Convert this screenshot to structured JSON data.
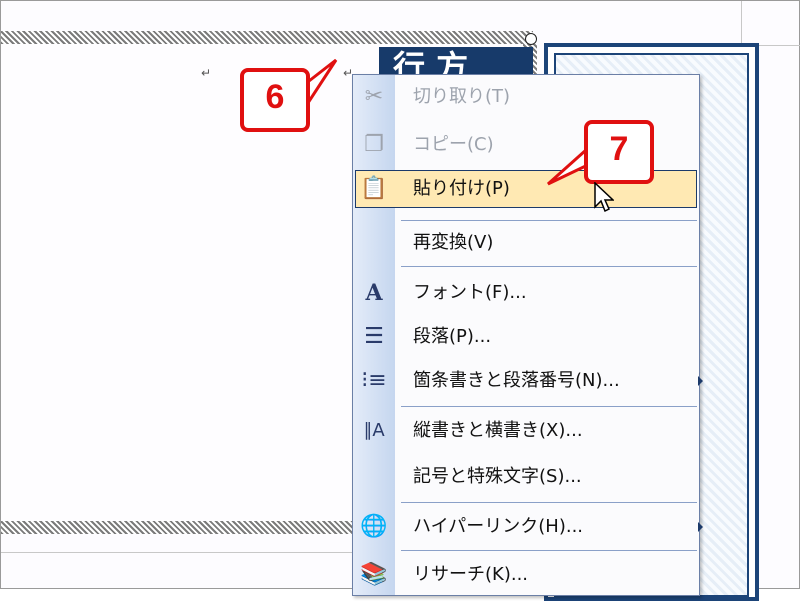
{
  "document": {
    "vertical_text": "行 方"
  },
  "callouts": {
    "step6": "6",
    "step7": "7"
  },
  "context_menu": {
    "items": [
      {
        "label": "切り取り(T)",
        "icon": "scissors-icon",
        "enabled": false
      },
      {
        "label": "コピー(C)",
        "icon": "copy-icon",
        "enabled": false
      },
      {
        "label": "貼り付け(P)",
        "icon": "paste-icon",
        "enabled": true,
        "highlighted": true
      },
      {
        "label": "再変換(V)",
        "icon": "",
        "enabled": true
      },
      {
        "label": "フォント(F)...",
        "icon": "font-icon",
        "enabled": true
      },
      {
        "label": "段落(P)...",
        "icon": "paragraph-icon",
        "enabled": true
      },
      {
        "label": "箇条書きと段落番号(N)...",
        "icon": "bullets-icon",
        "enabled": true
      },
      {
        "label": "縦書きと横書き(X)...",
        "icon": "text-direction-icon",
        "enabled": true
      },
      {
        "label": "記号と特殊文字(S)...",
        "icon": "",
        "enabled": true
      },
      {
        "label": "ハイパーリンク(H)...",
        "icon": "hyperlink-icon",
        "enabled": true
      },
      {
        "label": "リサーチ(K)...",
        "icon": "research-icon",
        "enabled": true
      }
    ]
  },
  "colors": {
    "highlight": "#ffe9b3",
    "callout": "#e01010",
    "panel_border": "#1c4478"
  }
}
